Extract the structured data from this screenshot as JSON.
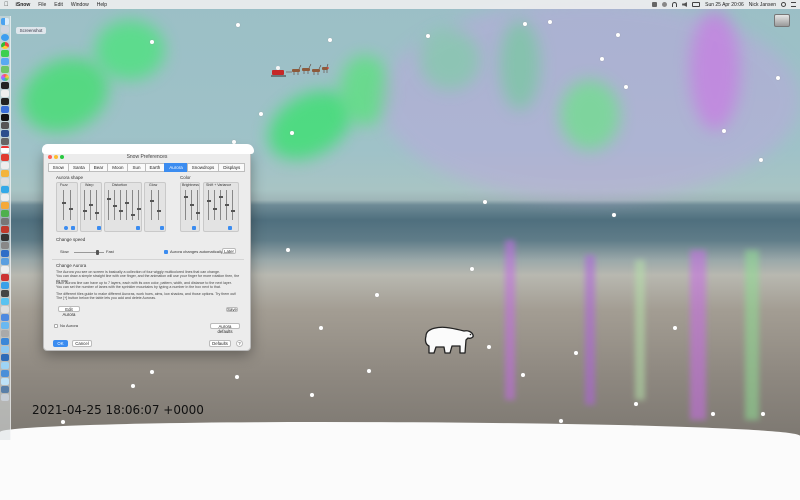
{
  "menubar": {
    "app": "iSnow",
    "menus": [
      "File",
      "Edit",
      "Window",
      "Help"
    ],
    "datetime": "Sun 25 Apr 20:06",
    "user": "Nick Jansen"
  },
  "desktop": {
    "tag": "Screenshot",
    "drive_label": "",
    "timestamp": "2021-04-25 18:06:07 +0000"
  },
  "window": {
    "title": "Snow Preferences",
    "tabs": [
      "Snow",
      "Santa",
      "Bear",
      "Moon",
      "Sun",
      "Earth",
      "Aurora",
      "Snowdrops",
      "Displays"
    ],
    "selected_tab": "Aurora",
    "aurora_shape_label": "Aurora shape",
    "color_label": "Color",
    "shape_groups": [
      "Fuzz",
      "Warp",
      "Distortion",
      "Glow"
    ],
    "color_groups": [
      "Brightness",
      "Shift + Variance"
    ],
    "change_speed_label": "Change speed",
    "slow_label": "Slow",
    "fast_label": "Fast",
    "auto_change_label": "Aurora changes automatically",
    "auto_change_checked": true,
    "now_button": "Later",
    "change_aurora_label": "Change Aurora",
    "paragraph1": "The Aurora you see on screen is basically a collection of four wiggly multicolored lines that can change.",
    "paragraph2": "You can draw a simple straight line with one finger, and the animation will use your finger for more rotation then, the rig may.",
    "paragraph3": "Each Aurora line can have up to 7 layers, each with its own color, pattern, width, and distance to the next layer.",
    "paragraph4": "You can set the number of lanes with the sprinkler mountains by typing a number in the box next to that.",
    "paragraph5": "The different tiles guide to make different Auroras, work hues, aims, low shadow, and those options. Try them out!",
    "paragraph6": "The [+] button below the table lets you add and delete Auroras.",
    "edit_button": "Edit Aurora",
    "save_button": "Save",
    "no_aurora_label": "No Aurora",
    "aurora_defaults_button": "Aurora defaults",
    "ok_button": "OK",
    "cancel_button": "Cancel",
    "defaults_button": "Defaults",
    "help_button": "?"
  },
  "colors": {
    "accent": "#3b8cf0",
    "aurora_green": "#43e06a",
    "aurora_purple": "#c267e6"
  }
}
